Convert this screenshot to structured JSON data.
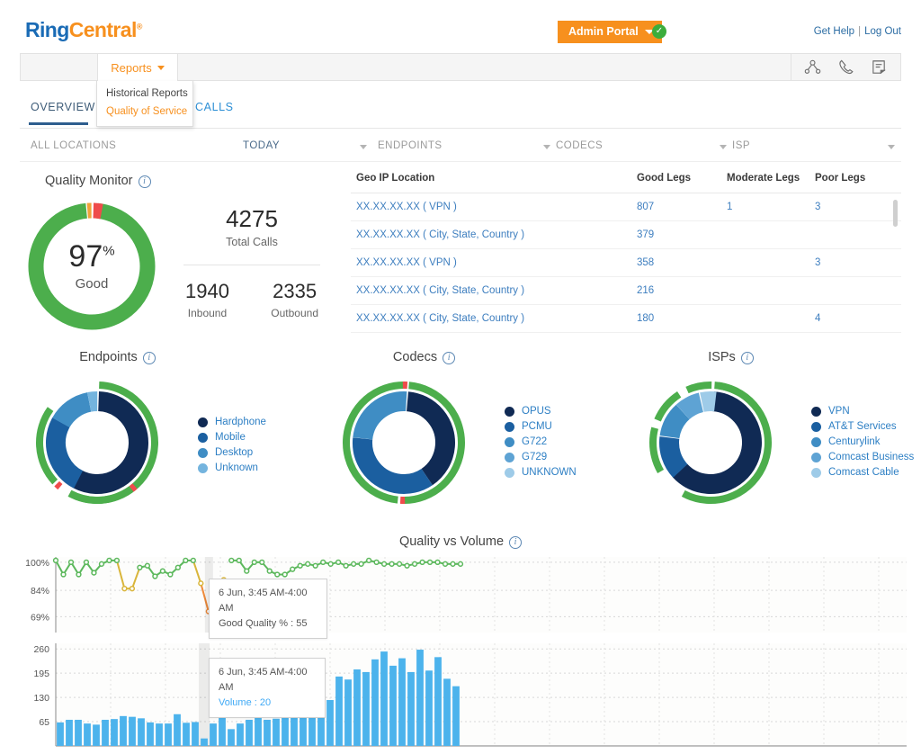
{
  "brand": {
    "name_part1": "Ring",
    "name_part2": "Central",
    "tm": "®"
  },
  "header": {
    "admin_portal_label": "Admin Portal",
    "status_icon": "check-circle-icon",
    "get_help": "Get Help",
    "separator": "|",
    "log_out": "Log Out"
  },
  "navbar": {
    "reports_label": "Reports",
    "dropdown": {
      "historical_reports": "Historical Reports",
      "quality_of_service": "Quality of Service"
    },
    "icons": [
      "org-chart-icon",
      "phone-icon",
      "report-icon"
    ]
  },
  "tabs": [
    {
      "label": "OVERVIEW",
      "active": true
    },
    {
      "label": "CALLS",
      "active": false
    }
  ],
  "filters": [
    {
      "label": "ALL LOCATIONS",
      "active": false,
      "caret": false
    },
    {
      "label": "TODAY",
      "active": true,
      "caret": true
    },
    {
      "label": "ENDPOINTS",
      "active": false,
      "caret": true
    },
    {
      "label": "CODECS",
      "active": false,
      "caret": true
    },
    {
      "label": "ISP",
      "active": false,
      "caret": true
    }
  ],
  "quality_monitor": {
    "title": "Quality Monitor",
    "info_icon": "info-icon",
    "percent": "97",
    "percent_symbol": "%",
    "quality_label": "Good",
    "total_calls_value": "4275",
    "total_calls_label": "Total Calls",
    "inbound_value": "1940",
    "inbound_label": "Inbound",
    "outbound_value": "2335",
    "outbound_label": "Outbound"
  },
  "geo_table": {
    "columns": [
      "Geo IP Location",
      "Good Legs",
      "Moderate Legs",
      "Poor Legs"
    ],
    "rows": [
      {
        "location": "XX.XX.XX.XX ( VPN )",
        "good": "807",
        "moderate": "1",
        "poor": "3"
      },
      {
        "location": "XX.XX.XX.XX ( City, State, Country )",
        "good": "379",
        "moderate": "",
        "poor": ""
      },
      {
        "location": "XX.XX.XX.XX ( VPN )",
        "good": "358",
        "moderate": "",
        "poor": "3"
      },
      {
        "location": "XX.XX.XX.XX ( City, State, Country )",
        "good": "216",
        "moderate": "",
        "poor": ""
      },
      {
        "location": "XX.XX.XX.XX ( City, State, Country )",
        "good": "180",
        "moderate": "",
        "poor": "4"
      }
    ]
  },
  "donuts": {
    "endpoints": {
      "title": "Endpoints",
      "info_icon": "info-icon",
      "legend": [
        {
          "label": "Hardphone",
          "color": "#102a54"
        },
        {
          "label": "Mobile",
          "color": "#1b5fa0"
        },
        {
          "label": "Desktop",
          "color": "#3f8dc4"
        },
        {
          "label": "Unknown",
          "color": "#74b4de"
        }
      ]
    },
    "codecs": {
      "title": "Codecs",
      "info_icon": "info-icon",
      "legend": [
        {
          "label": "OPUS",
          "color": "#102a54"
        },
        {
          "label": "PCMU",
          "color": "#1b5fa0"
        },
        {
          "label": "G722",
          "color": "#3f8dc4"
        },
        {
          "label": "G729",
          "color": "#5ea3d4"
        },
        {
          "label": "UNKNOWN",
          "color": "#9ecbe8"
        }
      ]
    },
    "isps": {
      "title": "ISPs",
      "info_icon": "info-icon",
      "legend": [
        {
          "label": "VPN",
          "color": "#102a54"
        },
        {
          "label": "AT&T Services",
          "color": "#1b5fa0"
        },
        {
          "label": "Centurylink",
          "color": "#3f8dc4"
        },
        {
          "label": "Comcast Business",
          "color": "#5ea3d4"
        },
        {
          "label": "Comcast Cable",
          "color": "#9ecbe8"
        }
      ]
    }
  },
  "quality_vs_volume": {
    "title": "Quality vs Volume",
    "info_icon": "info-icon",
    "tooltip_quality": {
      "time": "6 Jun, 3:45 AM-4:00 AM",
      "metric": "Good Quality % : 55"
    },
    "tooltip_volume": {
      "time": "6 Jun, 3:45 AM-4:00 AM",
      "metric": "Volume : 20"
    }
  },
  "colors": {
    "brand_orange": "#f7901e",
    "brand_blue": "#1a6bb5",
    "good_green": "#4cae4c",
    "moderate_orange": "#f0a33a",
    "poor_red": "#ef4b4b",
    "bar_blue": "#4cb3ec",
    "link_blue": "#3d7ebf"
  },
  "chart_data": [
    {
      "type": "donut",
      "title": "Quality Monitor",
      "labels": [
        "Good",
        "Moderate",
        "Poor"
      ],
      "values": [
        97,
        1,
        2
      ],
      "colors": [
        "#4cae4c",
        "#f0a33a",
        "#ef4b4b"
      ],
      "center_label": "97% Good"
    },
    {
      "type": "donut",
      "title": "Endpoints",
      "inner_ring": {
        "labels": [
          "Hardphone",
          "Mobile",
          "Desktop",
          "Unknown"
        ],
        "values": [
          57,
          26,
          14,
          3
        ],
        "colors": [
          "#102a54",
          "#1b5fa0",
          "#3f8dc4",
          "#74b4de"
        ]
      },
      "outer_ring": {
        "labels": [
          "Good",
          "Poor"
        ],
        "values": [
          98,
          2
        ],
        "colors": [
          "#4cae4c",
          "#ef4b4b"
        ]
      }
    },
    {
      "type": "donut",
      "title": "Codecs",
      "inner_ring": {
        "labels": [
          "OPUS",
          "PCMU",
          "G722",
          "G729",
          "UNKNOWN"
        ],
        "values": [
          39,
          36,
          25,
          0,
          0
        ],
        "colors": [
          "#102a54",
          "#1b5fa0",
          "#3f8dc4",
          "#5ea3d4",
          "#9ecbe8"
        ]
      },
      "outer_ring": {
        "labels": [
          "Good",
          "Poor"
        ],
        "values": [
          98,
          2
        ],
        "colors": [
          "#4cae4c",
          "#ef4b4b"
        ]
      }
    },
    {
      "type": "donut",
      "title": "ISPs",
      "inner_ring": {
        "labels": [
          "VPN",
          "AT&T Services",
          "Centurylink",
          "Comcast Business",
          "Comcast Cable"
        ],
        "values": [
          62,
          14,
          11,
          8,
          5
        ],
        "colors": [
          "#102a54",
          "#1b5fa0",
          "#3f8dc4",
          "#5ea3d4",
          "#9ecbe8"
        ]
      },
      "outer_ring": {
        "labels": [
          "Good"
        ],
        "values": [
          100
        ],
        "colors": [
          "#4cae4c"
        ]
      }
    },
    {
      "type": "line",
      "title": "Quality vs Volume — Good Quality %",
      "ylabel": "",
      "xlabel": "",
      "yticks": [
        "100%",
        "84%",
        "69%"
      ],
      "ytick_values": [
        100,
        84,
        69
      ],
      "ylim": [
        60,
        103
      ],
      "grid": true,
      "series": [
        {
          "name": "Good Quality %",
          "values": [
            101,
            93,
            100,
            93,
            100,
            94,
            99,
            101,
            101,
            85,
            85,
            97,
            98,
            92,
            95,
            93,
            97,
            101,
            101,
            88,
            72,
            63,
            90,
            101,
            101,
            95,
            100,
            100,
            95,
            93,
            93,
            96,
            98,
            99,
            98,
            100,
            99,
            100,
            98,
            99,
            99,
            101,
            100,
            99,
            99,
            99,
            98,
            99,
            100,
            100,
            100,
            99,
            99,
            99
          ]
        }
      ]
    },
    {
      "type": "bar",
      "title": "Quality vs Volume — Volume",
      "ylabel": "",
      "xlabel": "",
      "yticks": [
        "260",
        "195",
        "130",
        "65"
      ],
      "ytick_values": [
        260,
        195,
        130,
        65
      ],
      "ylim": [
        0,
        275
      ],
      "grid": true,
      "bar_color": "#4cb3ec",
      "values": [
        63,
        70,
        70,
        60,
        57,
        70,
        72,
        80,
        78,
        74,
        63,
        60,
        60,
        85,
        62,
        64,
        20,
        60,
        78,
        45,
        60,
        70,
        75,
        70,
        73,
        105,
        100,
        123,
        123,
        123,
        123,
        186,
        178,
        205,
        198,
        232,
        253,
        215,
        235,
        198,
        258,
        202,
        238,
        180,
        160
      ]
    }
  ]
}
